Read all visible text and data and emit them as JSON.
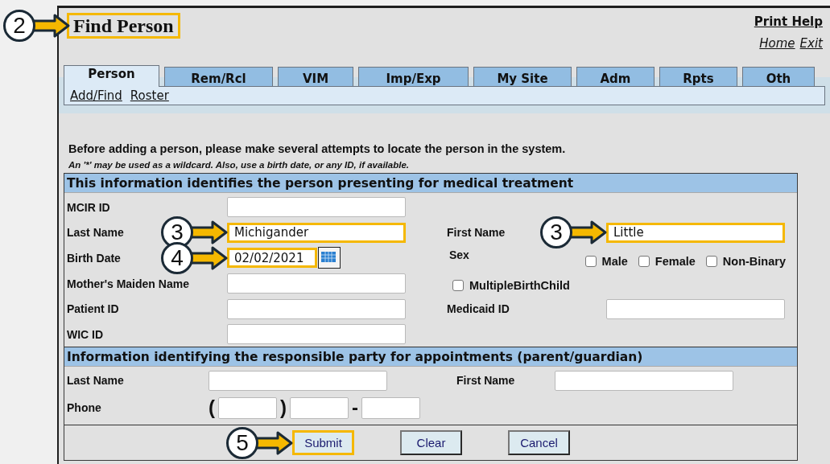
{
  "title": {
    "text": "Find Person",
    "callout": "2"
  },
  "print_help": "Print Help",
  "nav_links": [
    "Home",
    "Exit"
  ],
  "tabs": [
    {
      "label": "Person",
      "selected": true
    },
    {
      "label": "Rem/Rcl",
      "selected": false
    },
    {
      "label": "VIM",
      "selected": false
    },
    {
      "label": "Imp/Exp",
      "selected": false
    },
    {
      "label": "My Site",
      "selected": false
    },
    {
      "label": "Adm",
      "selected": false
    },
    {
      "label": "Rpts",
      "selected": false
    },
    {
      "label": "Oth",
      "selected": false
    }
  ],
  "subnav": [
    "Add/Find",
    "Roster"
  ],
  "intro": "Before adding a person, please make several attempts to locate the person in the system.",
  "hint": "An '*' may be used as a wildcard. Also, use a birth date, or any ID, if available.",
  "person_section": {
    "heading": "This information identifies the person presenting for medical treatment",
    "rows": [
      {
        "left": {
          "label": "MCIR ID"
        }
      },
      {
        "left": {
          "label": "Last Name",
          "value": "Michigander",
          "callout": "3"
        },
        "right": {
          "kind": "field",
          "label": "First Name",
          "value": "Little",
          "callout": "3"
        }
      },
      {
        "left": {
          "label": "Birth Date",
          "value": "02/02/2021",
          "callout": "4",
          "calendar": true
        },
        "right": {
          "kind": "options",
          "label": "Sex",
          "options": [
            {
              "label": "Male",
              "checked": false
            },
            {
              "label": "Female",
              "checked": false
            },
            {
              "label": "Non-Binary",
              "checked": false
            }
          ]
        }
      },
      {
        "left": {
          "label": "Mother's Maiden Name"
        },
        "right": {
          "kind": "checkbox",
          "label": "MultipleBirthChild",
          "checked": false
        }
      },
      {
        "left": {
          "label": "Patient ID"
        },
        "right": {
          "kind": "field",
          "label": "Medicaid ID"
        }
      },
      {
        "left": {
          "label": "WIC ID"
        }
      }
    ]
  },
  "guardian_section": {
    "heading": "Information identifying the responsible party for appointments (parent/guardian)",
    "last_name": {
      "label": "Last Name"
    },
    "first_name": {
      "label": "First Name"
    },
    "phone": {
      "label": "Phone",
      "open": "(",
      "close": ")",
      "dash": "-"
    }
  },
  "buttons": [
    {
      "label": "Submit",
      "callout": "5"
    },
    {
      "label": "Clear"
    },
    {
      "label": "Cancel"
    }
  ]
}
